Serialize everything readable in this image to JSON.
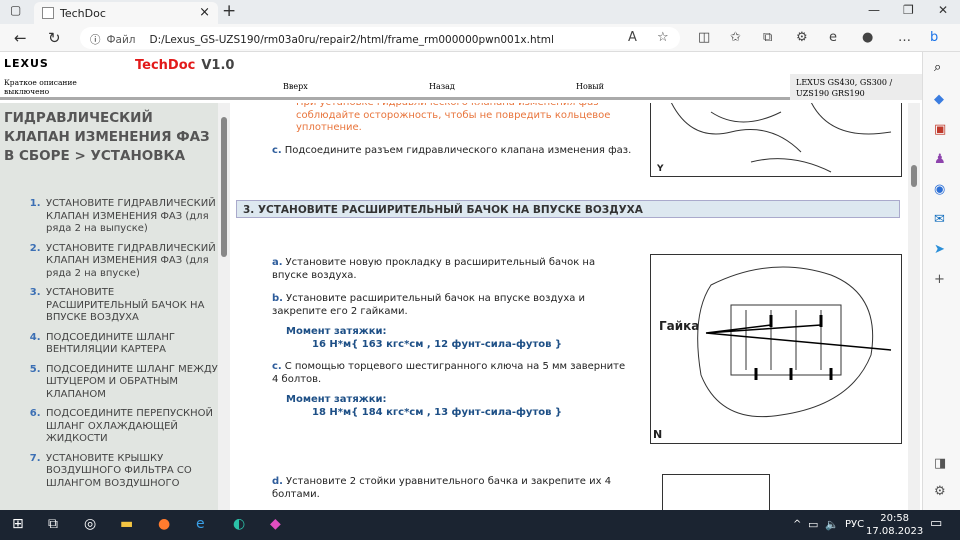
{
  "browser": {
    "tab_title": "TechDoc",
    "address_label": "Файл",
    "url": "D:/Lexus_GS-UZS190/rm03a0ru/repair2/html/frame_rm000000pwn001x.html"
  },
  "header": {
    "logo": "LEXUS",
    "app_name": "TechDoc",
    "version": "V1.0",
    "summary_line1": "Краткое описание",
    "summary_line2": "выключено",
    "nav_up": "Вверх",
    "nav_back": "Назад",
    "nav_new": "Новый",
    "model_line1": "LEXUS GS430, GS300 /",
    "model_line2": "UZS190 GRS190"
  },
  "sidebar": {
    "title": "ГИДРАВЛИЧЕСКИЙ КЛАПАН ИЗМЕНЕНИЯ ФАЗ В СБОРЕ > УСТАНОВКА",
    "items": [
      "УСТАНОВИТЕ ГИДРАВЛИЧЕСКИЙ КЛАПАН ИЗМЕНЕНИЯ ФАЗ (для ряда 2 на выпуске)",
      "УСТАНОВИТЕ ГИДРАВЛИЧЕСКИЙ КЛАПАН ИЗМЕНЕНИЯ ФАЗ (для ряда 2 на впуске)",
      "УСТАНОВИТЕ РАСШИРИТЕЛЬНЫЙ БАЧОК НА ВПУСКЕ ВОЗДУХА",
      "ПОДСОЕДИНИТЕ ШЛАНГ ВЕНТИЛЯЦИИ КАРТЕРА",
      "ПОДСОЕДИНИТЕ ШЛАНГ МЕЖДУ ШТУЦЕРОМ И ОБРАТНЫМ КЛАПАНОМ",
      "ПОДСОЕДИНИТЕ ПЕРЕПУСКНОЙ ШЛАНГ ОХЛАЖДАЮЩЕЙ ЖИДКОСТИ",
      "УСТАНОВИТЕ КРЫШКУ ВОЗДУШНОГО ФИЛЬТРА СО ШЛАНГОМ ВОЗДУШНОГО"
    ]
  },
  "main": {
    "caution": "При установке гидравлического клапана изменения фаз соблюдайте осторожность, чтобы не повредить кольцевое уплотнение.",
    "step_c_prev": {
      "marker": "c.",
      "text": "Подсоедините разъем гидравлического клапана изменения фаз."
    },
    "section": "3. УСТАНОВИТЕ РАСШИРИТЕЛЬНЫЙ БАЧОК НА ВПУСКЕ ВОЗДУХА",
    "steps": [
      {
        "marker": "a.",
        "text": "Установите новую прокладку в расширительный бачок на впуске воздуха."
      },
      {
        "marker": "b.",
        "text": "Установите расширительный бачок на впуске воздуха и закрепите его 2 гайками."
      },
      {
        "marker": "c.",
        "text": "С помощью торцевого шестигранного ключа на 5 мм заверните 4 болтов."
      },
      {
        "marker": "d.",
        "text": "Установите 2 стойки уравнительного бачка и закрепите их 4 болтами."
      }
    ],
    "torque1_label": "Момент затяжки:",
    "torque1_value": "16 Н*м{ 163 кгс*см , 12 фунт-сила-футов }",
    "torque2_label": "Момент затяжки:",
    "torque2_value": "18 Н*м{ 184 кгс*см , 13 фунт-сила-футов }",
    "fig1_letter": "Y",
    "fig2_label": "Гайка",
    "fig2_letter": "N"
  },
  "taskbar": {
    "lang": "РУС",
    "time": "20:58",
    "date": "17.08.2023"
  }
}
